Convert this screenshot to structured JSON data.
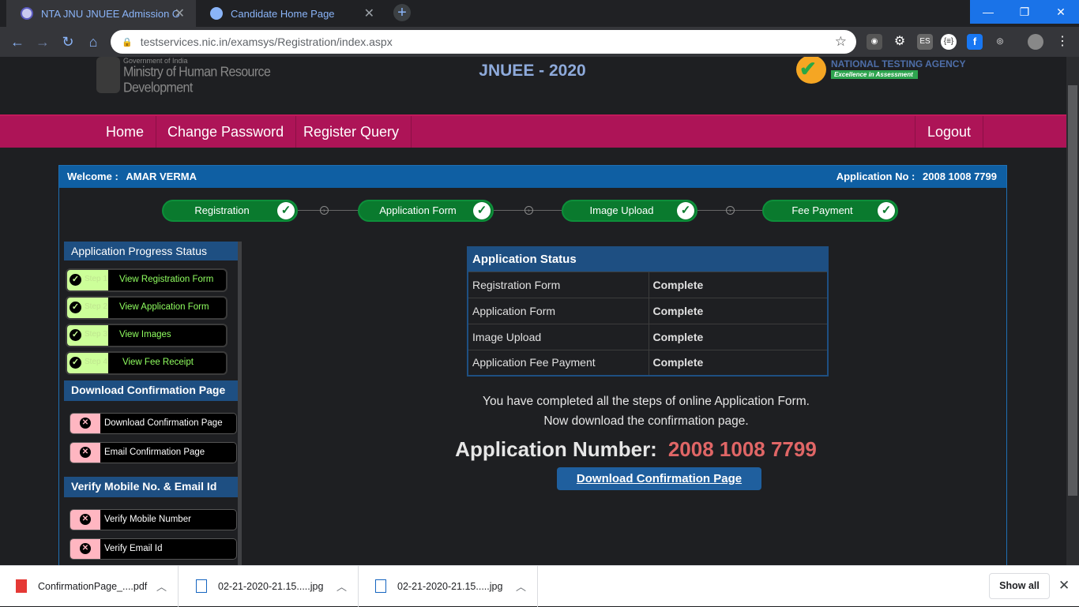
{
  "browser": {
    "tabs": [
      {
        "title": "NTA JNU JNUEE Admission Onlin",
        "icon": "nta-favicon",
        "active": true
      },
      {
        "title": "Candidate Home Page",
        "icon": "globe-icon",
        "active": false
      }
    ],
    "url": "testservices.nic.in/examsys/Registration/index.aspx",
    "extensions": [
      "raccoon-icon",
      "gear-icon",
      "es-icon",
      "json-icon",
      "facebook-icon",
      "incognito-icon",
      "profile-avatar",
      "more-icon"
    ]
  },
  "header": {
    "gov_line": "Government of India",
    "ministry": "Ministry of Human Resource Development",
    "exam_title": "JNUEE - 2020",
    "nta_name": "NATIONAL TESTING AGENCY",
    "nta_tagline": "Excellence in Assessment"
  },
  "nav": {
    "home": "Home",
    "change_password": "Change Password",
    "register_query": "Register Query",
    "logout": "Logout"
  },
  "panel": {
    "welcome_label": "Welcome :",
    "candidate_name": "AMAR VERMA",
    "app_no_label": "Application No :",
    "app_no": "2008 1008 7799"
  },
  "steps": [
    "Registration",
    "Application Form",
    "Image Upload",
    "Fee Payment"
  ],
  "sidebar": {
    "progress_title": "Application Progress Status",
    "progress_items": [
      {
        "step": "Step 1",
        "label": "View Registration Form"
      },
      {
        "step": "Step 2",
        "label": "View Application Form"
      },
      {
        "step": "Step 3",
        "label": "View Images"
      },
      {
        "step": "Step 4",
        "label": "View Fee Receipt"
      }
    ],
    "download_title": "Download Confirmation Page",
    "download_items": [
      "Download Confirmation Page",
      "Email Confirmation Page"
    ],
    "verify_title": "Verify Mobile No. & Email Id",
    "verify_items": [
      "Verify Mobile Number",
      "Verify Email Id"
    ]
  },
  "status_table": {
    "title": "Application Status",
    "rows": [
      {
        "item": "Registration Form",
        "status": "Complete"
      },
      {
        "item": "Application Form",
        "status": "Complete"
      },
      {
        "item": "Image Upload",
        "status": "Complete"
      },
      {
        "item": "Application Fee Payment",
        "status": "Complete"
      }
    ]
  },
  "message": {
    "line1": "You have completed all the steps of online Application Form.",
    "line2": "Now download the confirmation page."
  },
  "application_number": {
    "label": "Application Number:",
    "value": "2008 1008 7799"
  },
  "download_button": "Download Confirmation Page",
  "downloads_bar": {
    "items": [
      {
        "name": "ConfirmationPage_....pdf",
        "type": "pdf"
      },
      {
        "name": "02-21-2020-21.15.....jpg",
        "type": "jpg"
      },
      {
        "name": "02-21-2020-21.15.....jpg",
        "type": "jpg"
      }
    ],
    "show_all": "Show all"
  },
  "colors": {
    "nav_bg": "#ad1457",
    "panel_header": "#0f5fa3",
    "step_green": "#0a7a2e",
    "app_number": "#e06666"
  }
}
